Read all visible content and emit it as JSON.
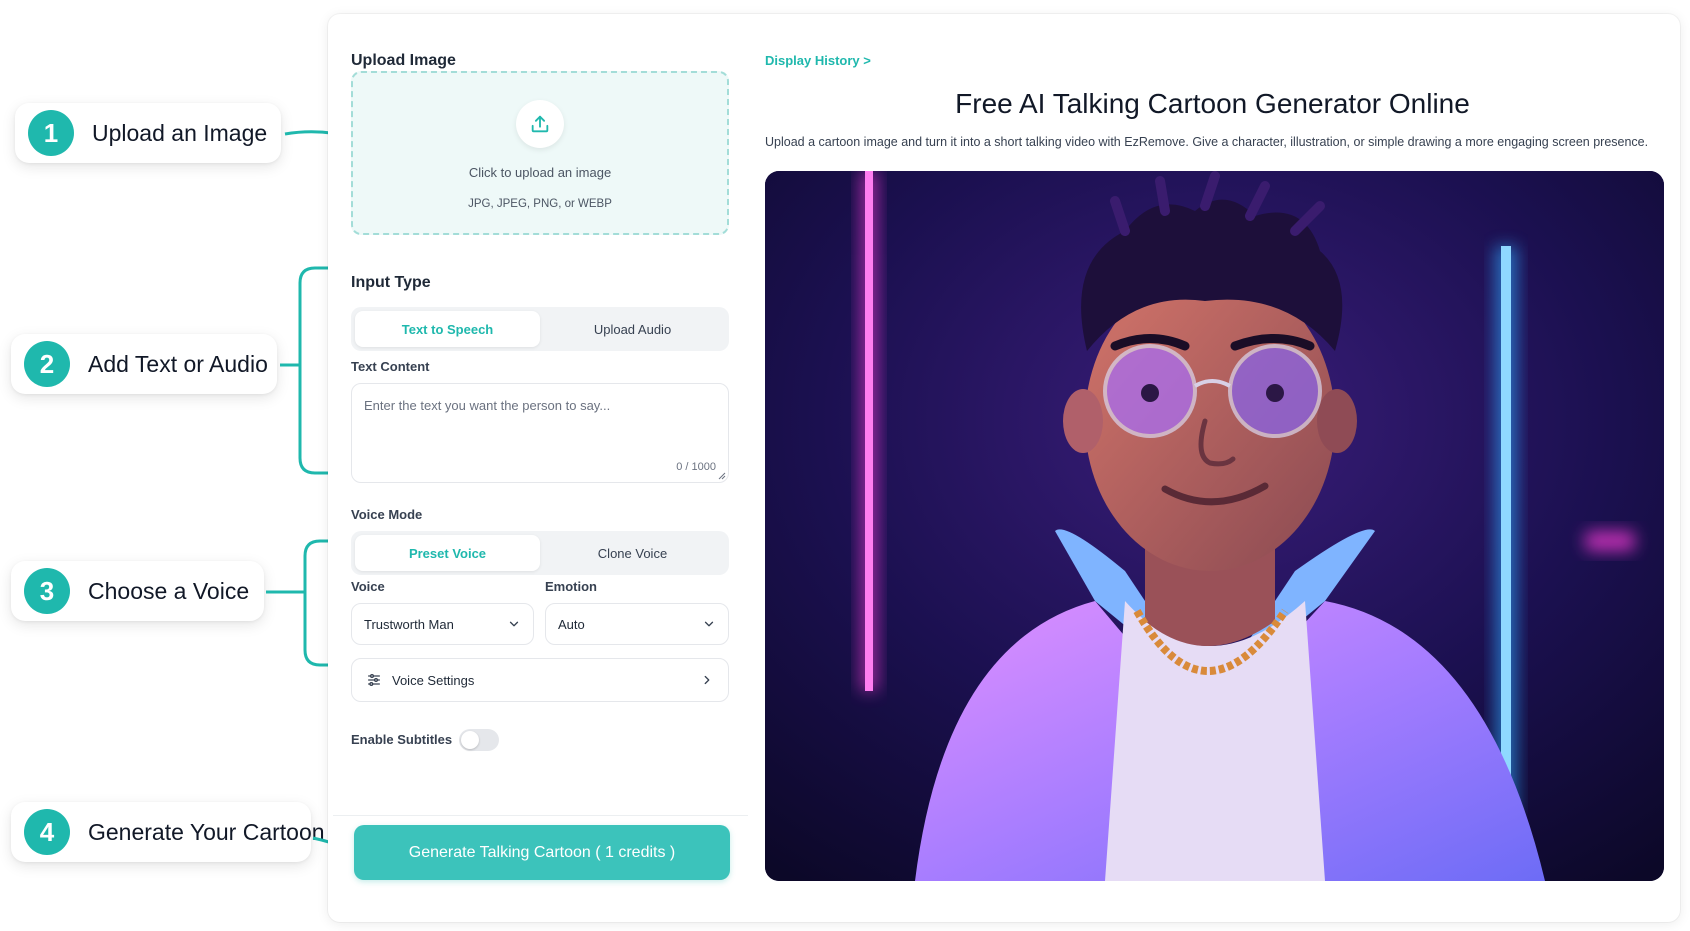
{
  "steps": [
    {
      "number": "1",
      "label": "Upload an Image"
    },
    {
      "number": "2",
      "label": "Add Text or Audio"
    },
    {
      "number": "3",
      "label": "Choose a Voice"
    },
    {
      "number": "4",
      "label": "Generate Your Cartoon"
    }
  ],
  "left_panel": {
    "upload": {
      "title": "Upload Image",
      "prompt": "Click to upload an image",
      "formats": "JPG, JPEG, PNG, or WEBP",
      "icon": "upload-icon"
    },
    "input_type": {
      "title": "Input Type",
      "tabs": [
        "Text to Speech",
        "Upload Audio"
      ],
      "active_tab": "Text to Speech"
    },
    "text_content": {
      "label": "Text Content",
      "placeholder": "Enter the text you want the person to say...",
      "counter": "0 / 1000"
    },
    "voice_mode": {
      "label": "Voice Mode",
      "tabs": [
        "Preset Voice",
        "Clone Voice"
      ],
      "active_tab": "Preset Voice"
    },
    "voice": {
      "label": "Voice",
      "value": "Trustworth Man"
    },
    "emotion": {
      "label": "Emotion",
      "value": "Auto"
    },
    "voice_settings": {
      "label": "Voice Settings",
      "icon": "sliders-icon"
    },
    "subtitles": {
      "label": "Enable Subtitles",
      "enabled": false
    },
    "generate_button": "Generate Talking Cartoon ( 1 credits )"
  },
  "right_panel": {
    "history_link": "Display History >",
    "title": "Free AI Talking Cartoon Generator Online",
    "description": "Upload a cartoon image and turn it into a short talking video with EzRemove. Give a character, illustration, or simple drawing a more engaging screen presence."
  },
  "colors": {
    "accent": "#1fb8ad",
    "button": "#3cc3bb",
    "upload_bg": "#eef9f8"
  }
}
